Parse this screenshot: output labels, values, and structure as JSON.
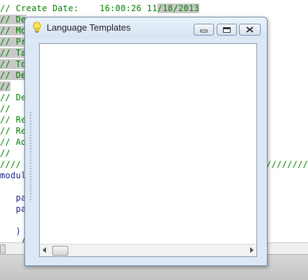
{
  "editor": {
    "lines": [
      {
        "text": "// Create Date:    16:00:26 11",
        "hl": "/18/2013"
      },
      {
        "text": "// De"
      },
      {
        "text": "// Mo"
      },
      {
        "text": "// Pr"
      },
      {
        "text": "// Ta"
      },
      {
        "text": "// To"
      },
      {
        "text": "// De"
      },
      {
        "text": "//"
      },
      {
        "text": "// De"
      },
      {
        "text": "//"
      },
      {
        "text": "// Re"
      },
      {
        "text": "// Re"
      },
      {
        "text": "// Ad"
      },
      {
        "text": "//"
      },
      {
        "text": "////",
        "right": "/////////"
      },
      {
        "text": "modul"
      },
      {
        "text": ""
      },
      {
        "text": "   pa"
      },
      {
        "text": "   pa"
      },
      {
        "text": ""
      },
      {
        "text": "   )"
      },
      {
        "text": "    ("
      }
    ]
  },
  "dialog": {
    "title": "Language Templates",
    "icon": "lightbulb-icon",
    "buttons": [
      "minimize-icon",
      "maximize-icon",
      "close-icon"
    ]
  },
  "colors": {
    "comment": "#008000",
    "keyword": "#1a1a8a",
    "highlight": "#c8c8c8",
    "dialog_frame": "#dce8f4"
  }
}
